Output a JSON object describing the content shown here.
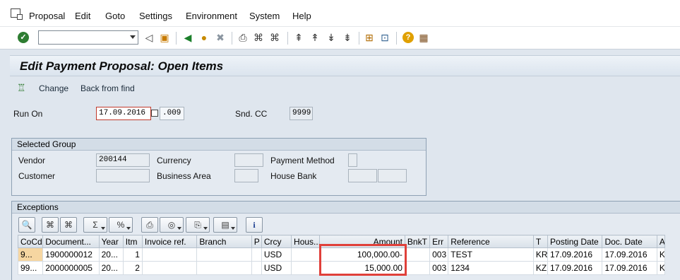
{
  "menu": {
    "items": [
      "Proposal",
      "Edit",
      "Goto",
      "Settings",
      "Environment",
      "System",
      "Help"
    ]
  },
  "toolbar": {
    "command_value": "",
    "icons": [
      "check-icon",
      "back-arrow-icon",
      "save-icon",
      "back-icon",
      "exit-icon",
      "cancel-icon",
      "print-icon",
      "find-icon",
      "find-next-icon",
      "first-page-icon",
      "previous-page-icon",
      "next-page-icon",
      "last-page-icon",
      "create-session-icon",
      "shortcut-icon",
      "help-icon",
      "layout-icon"
    ]
  },
  "page": {
    "title": "Edit Payment Proposal: Open Items"
  },
  "app_toolbar": {
    "change_label": "Change",
    "back_from_find_label": "Back from find"
  },
  "header": {
    "run_on_label": "Run On",
    "run_on_date": "17.09.2016",
    "run_on_id": ".009",
    "snd_cc_label": "Snd. CC",
    "snd_cc_value": "9999"
  },
  "selected_group": {
    "title": "Selected Group",
    "vendor_label": "Vendor",
    "vendor_value": "200144",
    "customer_label": "Customer",
    "customer_value": "",
    "currency_label": "Currency",
    "currency_value": "",
    "business_area_label": "Business Area",
    "business_area_value": "",
    "payment_method_label": "Payment Method",
    "payment_method_value": "",
    "house_bank_label": "House Bank",
    "house_bank_value": "",
    "house_bank_value2": ""
  },
  "exceptions": {
    "title": "Exceptions",
    "columns": [
      "CoCd",
      "Document...",
      "Year",
      "Itm",
      "Invoice ref.",
      "Branch",
      "P",
      "Crcy",
      "Hous...",
      "Amount",
      "BnkT",
      "Err",
      "Reference",
      "T",
      "Posting Date",
      "Doc. Date",
      "A"
    ],
    "rows": [
      [
        "9...",
        "1900000012",
        "20...",
        "1",
        "",
        "",
        "",
        "USD",
        "",
        "100,000.00-",
        "",
        "003",
        "TEST",
        "KR",
        "17.09.2016",
        "17.09.2016",
        "K"
      ],
      [
        "99...",
        "2000000005",
        "20...",
        "2",
        "",
        "",
        "",
        "USD",
        "",
        "15,000.00",
        "",
        "003",
        "1234",
        "KZ",
        "17.09.2016",
        "17.09.2016",
        "K"
      ]
    ]
  },
  "colors": {
    "highlight": "#e0403a",
    "selected_cell": "#f6d6a1"
  }
}
